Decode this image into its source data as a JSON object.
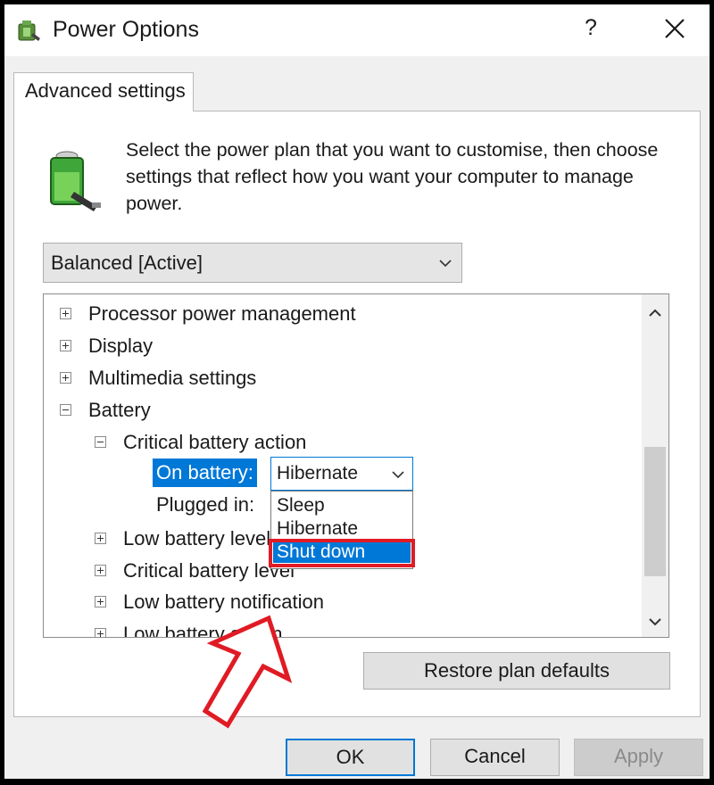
{
  "window": {
    "title": "Power Options",
    "help_label": "?"
  },
  "tab": {
    "label": "Advanced settings"
  },
  "description": "Select the power plan that you want to customise, then choose settings that reflect how you want your computer to manage power.",
  "plan_select": {
    "value": "Balanced [Active]"
  },
  "tree": {
    "items": [
      {
        "label": "Processor power management",
        "state": "collapsed"
      },
      {
        "label": "Display",
        "state": "collapsed"
      },
      {
        "label": "Multimedia settings",
        "state": "collapsed"
      },
      {
        "label": "Battery",
        "state": "expanded"
      },
      {
        "label": "Critical battery action",
        "state": "expanded"
      },
      {
        "label": "On battery:"
      },
      {
        "label": "Plugged in:"
      },
      {
        "label": "Low battery level",
        "state": "collapsed"
      },
      {
        "label": "Critical battery level",
        "state": "collapsed"
      },
      {
        "label": "Low battery notification",
        "state": "collapsed"
      },
      {
        "label": "Low battery action",
        "state": "collapsed"
      }
    ],
    "combo_value": "Hibernate",
    "dropdown_options": [
      "Sleep",
      "Hibernate",
      "Shut down"
    ],
    "highlighted_option": "Shut down"
  },
  "buttons": {
    "restore": "Restore plan defaults",
    "ok": "OK",
    "cancel": "Cancel",
    "apply": "Apply"
  },
  "colors": {
    "accent": "#0078d7",
    "annotation": "#e01b24"
  }
}
